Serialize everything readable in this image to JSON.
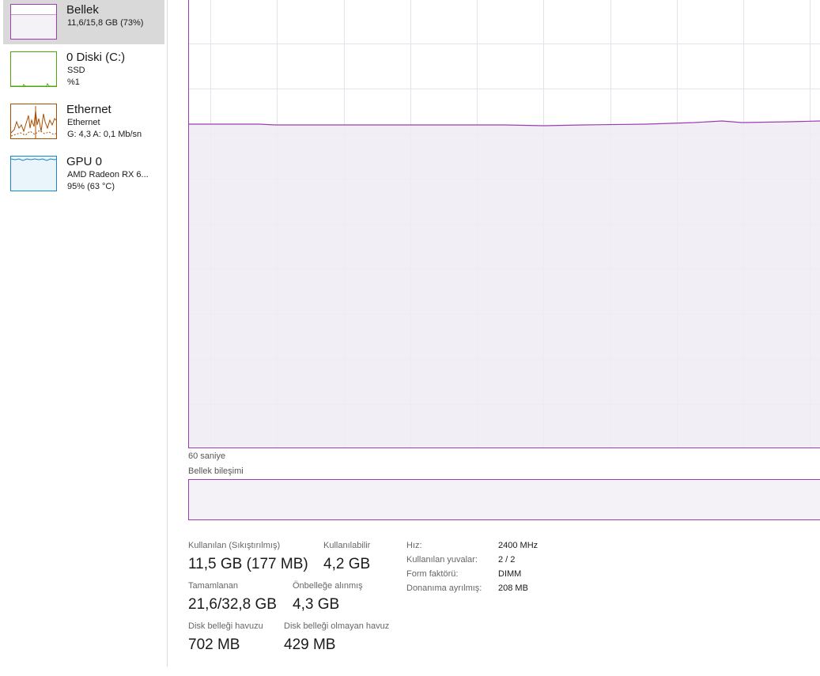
{
  "sidebar": {
    "items": [
      {
        "title": "Bellek",
        "line1": "11,6/15,8 GB (73%)",
        "line2": ""
      },
      {
        "title": "0 Diski (C:)",
        "line1": "SSD",
        "line2": "%1"
      },
      {
        "title": "Ethernet",
        "line1": "Ethernet",
        "line2": "G: 4,3  A: 0,1 Mb/sn"
      },
      {
        "title": "GPU 0",
        "line1": "AMD Radeon RX 6...",
        "line2": "95% (63 °C)"
      }
    ]
  },
  "graph": {
    "time_label": "60 saniye",
    "usage_fraction": 0.73
  },
  "composition": {
    "label": "Bellek bileşimi"
  },
  "stats": {
    "in_use_label": "Kullanılan (Sıkıştırılmış)",
    "in_use_value": "11,5 GB (177 MB)",
    "available_label": "Kullanılabilir",
    "available_value": "4,2 GB",
    "committed_label": "Tamamlanan",
    "committed_value": "21,6/32,8 GB",
    "cached_label": "Önbelleğe alınmış",
    "cached_value": "4,3 GB",
    "paged_label": "Disk belleği havuzu",
    "paged_value": "702 MB",
    "nonpaged_label": "Disk belleği olmayan havuz",
    "nonpaged_value": "429 MB"
  },
  "details": {
    "speed_key": "Hız:",
    "speed_val": "2400 MHz",
    "slots_key": "Kullanılan yuvalar:",
    "slots_val": "2 / 2",
    "form_key": "Form faktörü:",
    "form_val": "DIMM",
    "reserved_key": "Donanıma ayrılmış:",
    "reserved_val": "208 MB"
  },
  "colors": {
    "memory": "#9b3fb0",
    "disk": "#4da60c",
    "ethernet": "#a74f01",
    "gpu": "#1a86c6"
  }
}
